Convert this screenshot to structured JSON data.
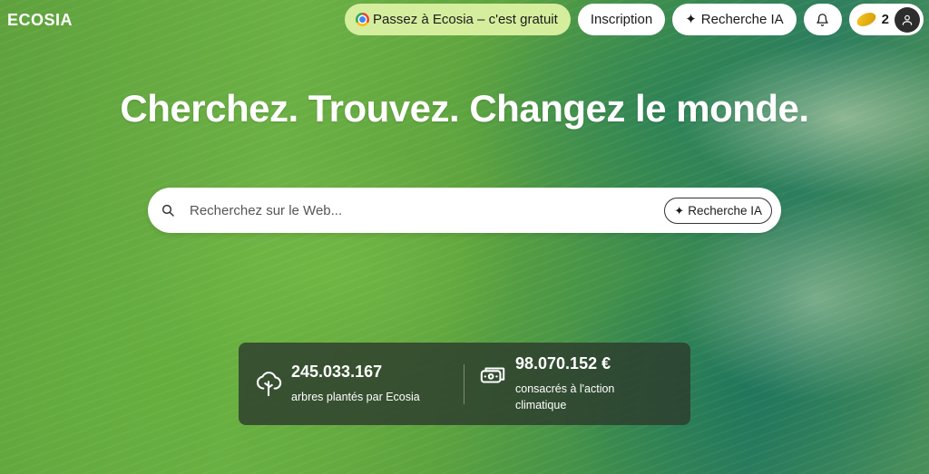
{
  "brand": {
    "logo_text": "ECOSIA"
  },
  "header": {
    "promo_label": "Passez à Ecosia – c'est gratuit",
    "signup_label": "Inscription",
    "ai_search_label": "Recherche IA",
    "seed_count": "2"
  },
  "hero": {
    "headline": "Cherchez. Trouvez. Changez le monde."
  },
  "search": {
    "placeholder": "Recherchez sur le Web...",
    "ai_button_label": "Recherche IA"
  },
  "stats": {
    "trees": {
      "value": "245.033.167",
      "label": "arbres plantés par Ecosia"
    },
    "money": {
      "value": "98.070.152 €",
      "label": "consacrés à l'action climatique"
    }
  },
  "icons": {
    "promo": "chrome-icon",
    "ai": "sparkle-icon",
    "bell": "bell-icon",
    "seed": "seed-icon",
    "avatar": "user-icon",
    "search": "search-icon",
    "trees": "tree-icon",
    "money": "banknote-icon"
  },
  "colors": {
    "promo_bg": "#d5ee9d",
    "stats_bg": "#2d3c2d",
    "seed": "#f3c623"
  }
}
